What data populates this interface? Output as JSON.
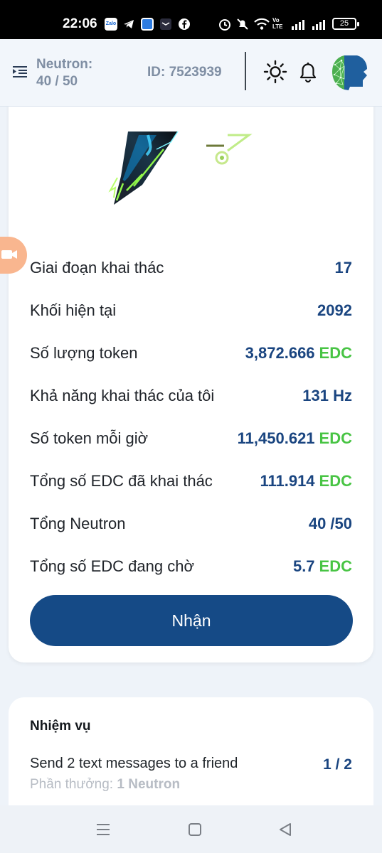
{
  "status_bar": {
    "time": "22:06",
    "network_label": "Vo LTE",
    "battery": "25",
    "notification_icons": [
      "zalo-icon",
      "telegram-icon",
      "app-icon",
      "mail-icon",
      "facebook-icon"
    ],
    "system_icons": [
      "alarm-icon",
      "mute-icon",
      "wifi-icon",
      "signal-icon",
      "signal-icon"
    ]
  },
  "header": {
    "neutron_label": "Neutron:",
    "neutron_value": "40 / 50",
    "id_text": "ID: 7523939"
  },
  "stats": [
    {
      "label": "Giai đoạn khai thác",
      "value": "17",
      "unit": ""
    },
    {
      "label": "Khối hiện tại",
      "value": "2092",
      "unit": ""
    },
    {
      "label": "Số lượng token",
      "value": "3,872.666",
      "unit": "EDC"
    },
    {
      "label": "Khả năng khai thác của tôi",
      "value": "131 Hz",
      "unit": ""
    },
    {
      "label": "Số token mỗi giờ",
      "value": "11,450.621",
      "unit": "EDC"
    },
    {
      "label": "Tổng số EDC đã khai thác",
      "value": "111.914",
      "unit": "EDC"
    },
    {
      "label": "Tổng Neutron",
      "value": "40 /50",
      "unit": ""
    },
    {
      "label": "Tổng số EDC đang chờ",
      "value": "5.7",
      "unit": "EDC"
    }
  ],
  "claim_button": "Nhận",
  "task": {
    "title": "Nhiệm vụ",
    "name": "Send 2 text messages to a friend",
    "progress": "1 / 2",
    "reward_label": "Phần thưởng:",
    "reward_value": "1 Neutron"
  },
  "colors": {
    "primary": "#154a86",
    "value": "#1a4580",
    "currency": "#48c444",
    "background": "#eef3f9"
  }
}
